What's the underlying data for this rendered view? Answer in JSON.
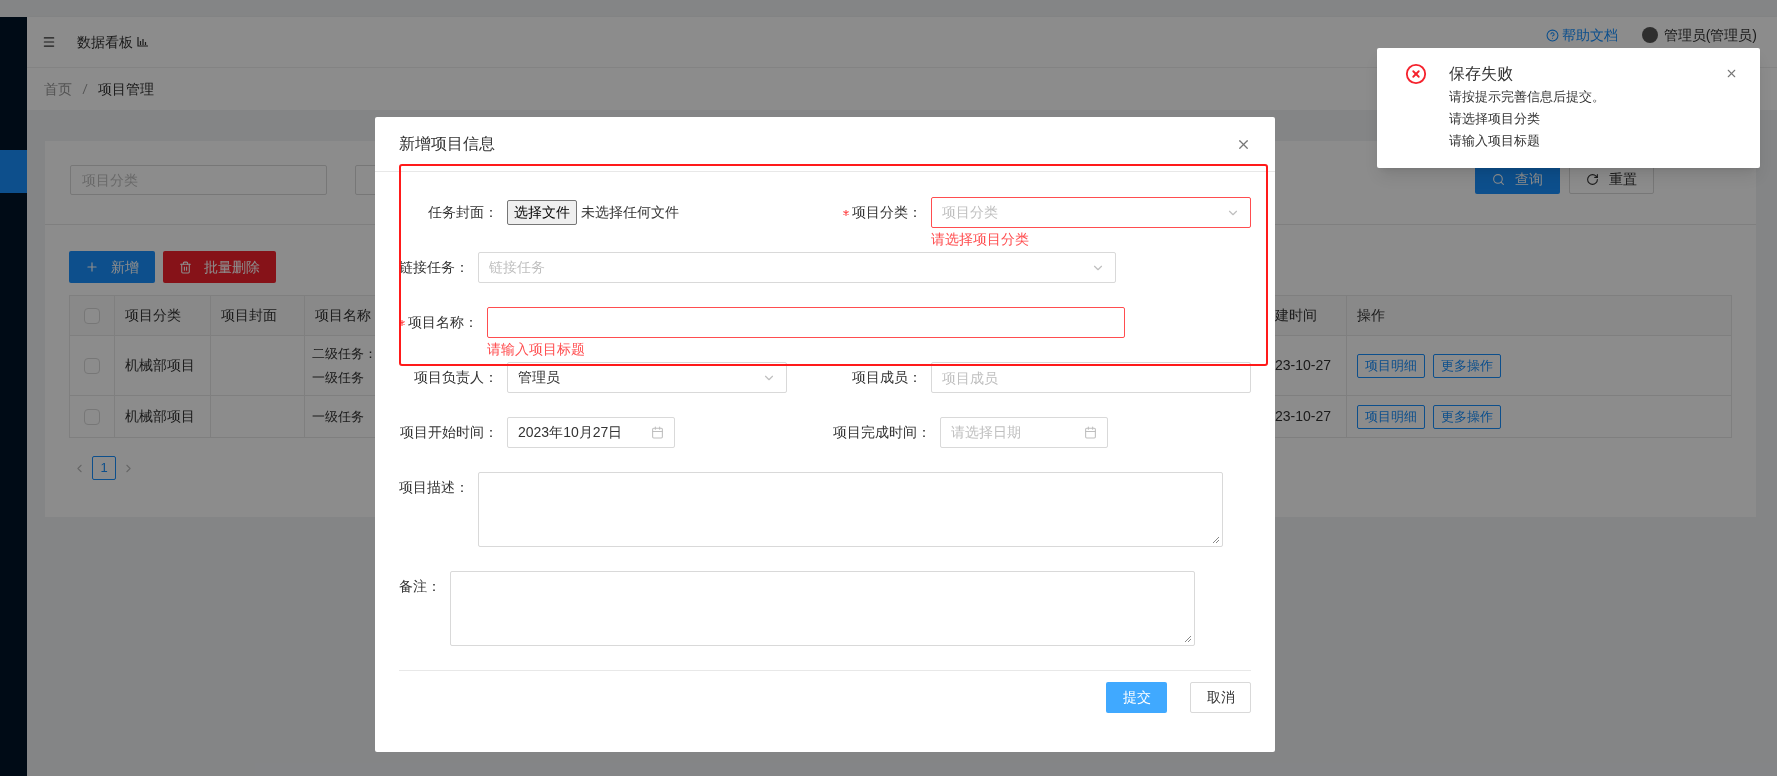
{
  "header": {
    "title": "数据看板",
    "help": "帮助文档",
    "user": "管理员(管理员)"
  },
  "breadcrumb": [
    {
      "label": "首页",
      "selected": false
    },
    {
      "label": "项目管理",
      "selected": true
    }
  ],
  "search": {
    "fields": [
      {
        "placeholder": "项目分类"
      }
    ],
    "buttons": [
      {
        "label": "查询",
        "kind": "primary"
      },
      {
        "label": "重置",
        "kind": "default"
      }
    ]
  },
  "toolbar": [
    {
      "label": "新增",
      "kind": "add"
    },
    {
      "label": "批量删除",
      "kind": "delete"
    }
  ],
  "table": {
    "checked": false,
    "columns": [
      "项目分类",
      "项目封面",
      "项目名称",
      "建时间",
      "操作"
    ],
    "rows": [
      {
        "checked": false,
        "category": "机械部项目",
        "name": [
          "二级任务：",
          "一级任务"
        ],
        "created": "23-10-27",
        "actions": [
          "项目明细",
          "更多操作"
        ]
      },
      {
        "checked": false,
        "category": "机械部项目",
        "name": [
          "一级任务"
        ],
        "created": "23-10-27",
        "actions": [
          "项目明细",
          "更多操作"
        ]
      }
    ]
  },
  "pagination": [
    {
      "label": "1",
      "selected": true
    }
  ],
  "dialog": {
    "title": "新增项目信息",
    "rows": [
      {
        "fields": [
          {
            "kind": "file",
            "label": "任务封面：",
            "required": false,
            "button": "选择文件",
            "value": "未选择任何文件"
          },
          {
            "kind": "select",
            "label": "项目分类：",
            "required": true,
            "placeholder": "项目分类",
            "error": "请选择项目分类"
          }
        ]
      },
      {
        "fields": [
          {
            "kind": "select",
            "label": "链接任务：",
            "required": false,
            "placeholder": "链接任务"
          }
        ]
      },
      {
        "fields": [
          {
            "kind": "input",
            "label": "项目名称：",
            "required": true,
            "error": "请输入项目标题"
          }
        ]
      },
      {
        "fields": [
          {
            "kind": "select",
            "label": "项目负责人：",
            "required": false,
            "value": "管理员"
          },
          {
            "kind": "input",
            "label": "项目成员：",
            "required": false,
            "placeholder": "项目成员"
          }
        ]
      },
      {
        "fields": [
          {
            "kind": "date",
            "label": "项目开始时间：",
            "required": false,
            "value": "2023年10月27日"
          },
          {
            "kind": "date",
            "label": "项目完成时间：",
            "required": false,
            "placeholder": "请选择日期"
          }
        ]
      },
      {
        "fields": [
          {
            "kind": "textarea",
            "label": "项目描述：",
            "required": false
          }
        ]
      },
      {
        "fields": [
          {
            "kind": "textarea",
            "label": "备注：",
            "required": false
          }
        ]
      }
    ],
    "buttons": [
      {
        "label": "提交",
        "kind": "primary"
      },
      {
        "label": "取消",
        "kind": "default"
      }
    ]
  },
  "toast": {
    "kind": "error",
    "title": "保存失败",
    "lines": [
      "请按提示完善信息后提交。",
      "请选择项目分类",
      "请输入项目标题"
    ]
  }
}
